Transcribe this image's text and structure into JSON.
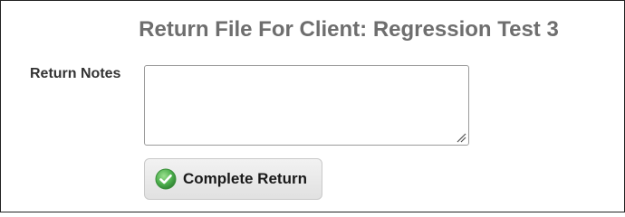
{
  "header": {
    "title": "Return File For Client: Regression Test 3"
  },
  "form": {
    "notes_label": "Return Notes",
    "notes_value": "",
    "submit_label": "Complete Return",
    "submit_icon": "check-circle-icon"
  },
  "colors": {
    "title_text": "#6e6e6e",
    "icon_green": "#4cae4c",
    "button_bg": "#e6e6e6"
  }
}
